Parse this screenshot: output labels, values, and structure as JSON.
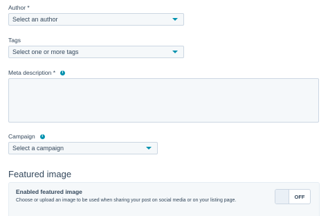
{
  "author": {
    "label": "Author *",
    "value": "Select an author"
  },
  "tags": {
    "label": "Tags",
    "value": "Select one or more tags"
  },
  "meta_description": {
    "label": "Meta description *",
    "value": ""
  },
  "campaign": {
    "label": "Campaign",
    "value": "Select a campaign"
  },
  "featured_image": {
    "section_title": "Featured image",
    "toggle_title": "Enabled featured image",
    "toggle_description": "Choose or upload an image to be used when sharing your post on social media or on your listing page.",
    "toggle_state": "OFF"
  },
  "icons": {
    "info": "info-icon",
    "caret": "chevron-down-icon"
  },
  "colors": {
    "accent": "#0091ae",
    "text": "#33475b",
    "field_bg": "#f5f8fa",
    "border": "#cbd6e2"
  }
}
